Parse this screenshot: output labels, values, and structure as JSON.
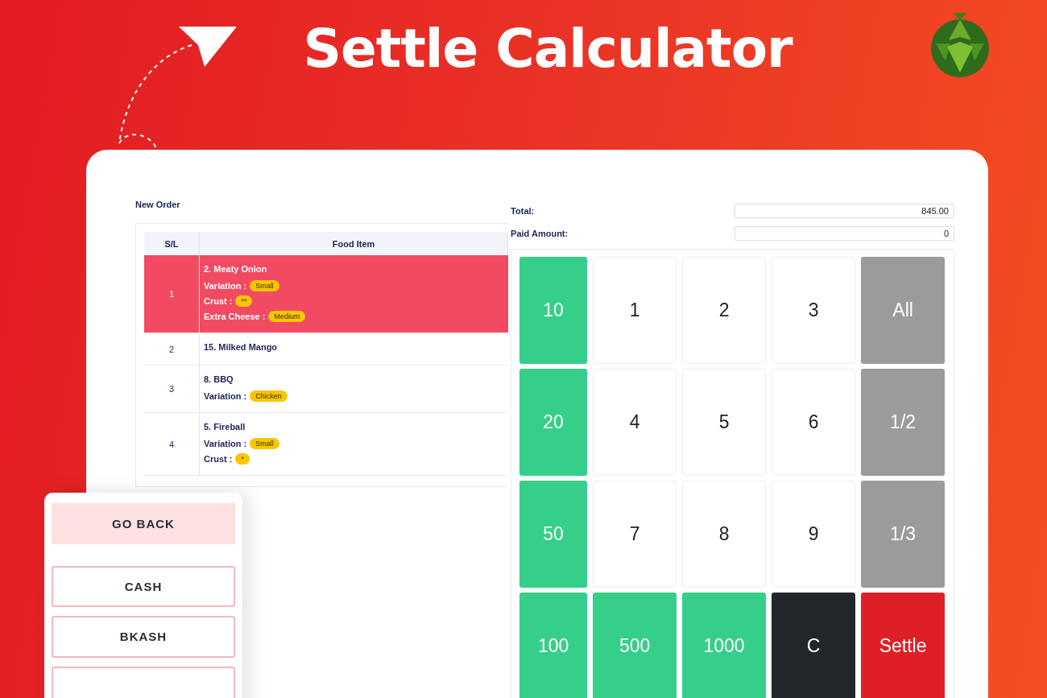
{
  "title": "Settle Calculator",
  "order": {
    "heading": "New Order",
    "columns": [
      "S/L",
      "Food Item"
    ],
    "rows": [
      {
        "sl": "1",
        "name": "2. Meaty Onion",
        "selected": true,
        "options": [
          {
            "label": "Variation :",
            "value": "Small"
          },
          {
            "label": "Crust :",
            "value": "**"
          },
          {
            "label": "Extra Cheese :",
            "value": "Medium"
          }
        ]
      },
      {
        "sl": "2",
        "name": "15. Milked Mango",
        "selected": false,
        "options": []
      },
      {
        "sl": "3",
        "name": "8. BBQ",
        "selected": false,
        "options": [
          {
            "label": "Variation :",
            "value": "Chicken"
          }
        ]
      },
      {
        "sl": "4",
        "name": "5. Fireball",
        "selected": false,
        "options": [
          {
            "label": "Variation :",
            "value": "Small"
          },
          {
            "label": "Crust :",
            "value": "*"
          }
        ]
      }
    ]
  },
  "totals": [
    {
      "label": "Total:",
      "value": "845.00"
    },
    {
      "label": "Paid Amount:",
      "value": "0"
    }
  ],
  "keypad": [
    {
      "label": "10",
      "kind": "amount"
    },
    {
      "label": "1",
      "kind": "digit"
    },
    {
      "label": "2",
      "kind": "digit"
    },
    {
      "label": "3",
      "kind": "digit"
    },
    {
      "label": "All",
      "kind": "split"
    },
    {
      "label": "20",
      "kind": "amount"
    },
    {
      "label": "4",
      "kind": "digit"
    },
    {
      "label": "5",
      "kind": "digit"
    },
    {
      "label": "6",
      "kind": "digit"
    },
    {
      "label": "1/2",
      "kind": "split"
    },
    {
      "label": "50",
      "kind": "amount"
    },
    {
      "label": "7",
      "kind": "digit"
    },
    {
      "label": "8",
      "kind": "digit"
    },
    {
      "label": "9",
      "kind": "digit"
    },
    {
      "label": "1/3",
      "kind": "split"
    },
    {
      "label": "100",
      "kind": "amount"
    },
    {
      "label": "500",
      "kind": "amount"
    },
    {
      "label": "1000",
      "kind": "amount"
    },
    {
      "label": "C",
      "kind": "clear"
    },
    {
      "label": "Settle",
      "kind": "settle"
    }
  ],
  "payment_panel": {
    "back": "GO BACK",
    "methods": [
      "CASH",
      "BKASH"
    ]
  }
}
